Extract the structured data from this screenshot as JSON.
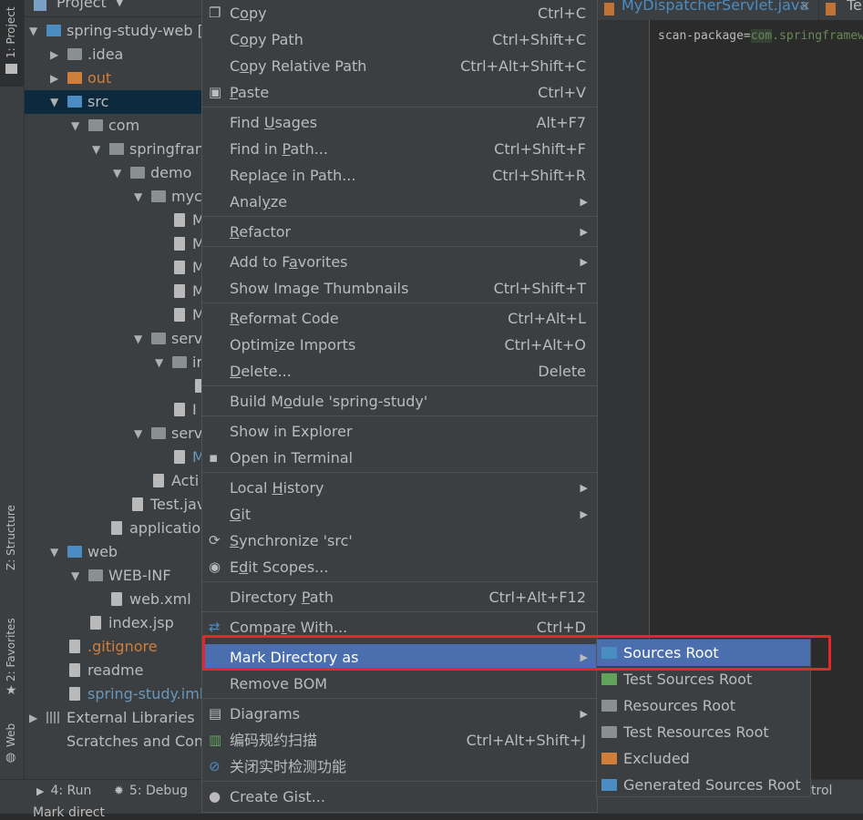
{
  "left_strip": {
    "project_tab": "1: Project",
    "structure_tab": "Z: Structure",
    "favorites_tab": "2: Favorites",
    "web_tab": "Web"
  },
  "project_panel": {
    "header": "Project",
    "tree": [
      {
        "label": "spring-study-web [",
        "kind": "folder-b",
        "expanded": true
      },
      {
        "label": ".idea",
        "kind": "folder",
        "expanded": false
      },
      {
        "label": "out",
        "kind": "folder-o",
        "expanded": false
      },
      {
        "label": "src",
        "kind": "folder-b",
        "expanded": true
      },
      {
        "label": "com",
        "kind": "folder",
        "expanded": true
      },
      {
        "label": "springfran",
        "kind": "folder",
        "expanded": true
      },
      {
        "label": "demo",
        "kind": "folder",
        "expanded": true
      },
      {
        "label": "myc",
        "kind": "folder",
        "expanded": true
      },
      {
        "label": "M",
        "kind": "file"
      },
      {
        "label": "M",
        "kind": "file"
      },
      {
        "label": "M",
        "kind": "file"
      },
      {
        "label": "M",
        "kind": "file"
      },
      {
        "label": "M",
        "kind": "file"
      },
      {
        "label": "serv",
        "kind": "folder",
        "expanded": true
      },
      {
        "label": "in",
        "kind": "folder",
        "expanded": true
      },
      {
        "label": "",
        "kind": "file"
      },
      {
        "label": "I",
        "kind": "file"
      },
      {
        "label": "serv",
        "kind": "folder",
        "expanded": true
      },
      {
        "label": "M",
        "kind": "file"
      },
      {
        "label": "Acti",
        "kind": "file"
      },
      {
        "label": "Test.java",
        "kind": "file"
      },
      {
        "label": "application.p",
        "kind": "file"
      },
      {
        "label": "web",
        "kind": "folder-b",
        "expanded": true
      },
      {
        "label": "WEB-INF",
        "kind": "folder",
        "expanded": true
      },
      {
        "label": "web.xml",
        "kind": "file"
      },
      {
        "label": "index.jsp",
        "kind": "file"
      },
      {
        "label": ".gitignore",
        "kind": "file"
      },
      {
        "label": "readme",
        "kind": "file"
      },
      {
        "label": "spring-study.iml",
        "kind": "file"
      },
      {
        "label": "External Libraries",
        "kind": "lib",
        "expanded": false
      },
      {
        "label": "Scratches and Cons",
        "kind": "scratch"
      }
    ]
  },
  "editor": {
    "tab_active": "MyDispatcherServlet.java",
    "tab_next": "Te",
    "code_attr": "scan-package",
    "code_eq": "=",
    "code_val_1": "com",
    "code_val_2": ".springframew"
  },
  "context_menu": {
    "items": [
      {
        "label": "Copy",
        "shortcut": "Ctrl+C",
        "icon": "copy-icon"
      },
      {
        "label": "Copy Path",
        "shortcut": "Ctrl+Shift+C"
      },
      {
        "label": "Copy Relative Path",
        "shortcut": "Ctrl+Alt+Shift+C"
      },
      {
        "label": "Paste",
        "shortcut": "Ctrl+V",
        "icon": "paste-icon"
      },
      {
        "label": "Find Usages",
        "shortcut": "Alt+F7"
      },
      {
        "label": "Find in Path...",
        "shortcut": "Ctrl+Shift+F"
      },
      {
        "label": "Replace in Path...",
        "shortcut": "Ctrl+Shift+R"
      },
      {
        "label": "Analyze",
        "shortcut": "",
        "submenu": true
      },
      {
        "label": "Refactor",
        "shortcut": "",
        "submenu": true
      },
      {
        "label": "Add to Favorites",
        "shortcut": "",
        "submenu": true
      },
      {
        "label": "Show Image Thumbnails",
        "shortcut": "Ctrl+Shift+T"
      },
      {
        "label": "Reformat Code",
        "shortcut": "Ctrl+Alt+L"
      },
      {
        "label": "Optimize Imports",
        "shortcut": "Ctrl+Alt+O"
      },
      {
        "label": "Delete...",
        "shortcut": "Delete"
      },
      {
        "label": "Build Module 'spring-study'",
        "shortcut": ""
      },
      {
        "label": "Show in Explorer",
        "shortcut": ""
      },
      {
        "label": "Open in Terminal",
        "shortcut": "",
        "icon": "terminal-icon"
      },
      {
        "label": "Local History",
        "shortcut": "",
        "submenu": true
      },
      {
        "label": "Git",
        "shortcut": "",
        "submenu": true
      },
      {
        "label": "Synchronize 'src'",
        "shortcut": "",
        "icon": "sync-icon"
      },
      {
        "label": "Edit Scopes...",
        "shortcut": "",
        "icon": "scope-icon"
      },
      {
        "label": "Directory Path",
        "shortcut": "Ctrl+Alt+F12"
      },
      {
        "label": "Compare With...",
        "shortcut": "Ctrl+D",
        "icon": "compare-icon"
      },
      {
        "label": "Mark Directory as",
        "shortcut": "",
        "submenu": true,
        "highlighted": true
      },
      {
        "label": "Remove BOM",
        "shortcut": ""
      },
      {
        "label": "Diagrams",
        "shortcut": "",
        "submenu": true,
        "icon": "diagram-icon"
      },
      {
        "label": "编码规约扫描",
        "shortcut": "Ctrl+Alt+Shift+J",
        "icon": "scan-icon"
      },
      {
        "label": "关闭实时检测功能",
        "shortcut": "",
        "icon": "stop-icon"
      },
      {
        "label": "Create Gist...",
        "shortcut": "",
        "icon": "github-icon"
      }
    ]
  },
  "submenu": {
    "items": [
      {
        "label": "Sources Root",
        "color": "#4b8cc2",
        "highlighted": true
      },
      {
        "label": "Test Sources Root",
        "color": "#62a35c"
      },
      {
        "label": "Resources Root",
        "color": "#8a8f92"
      },
      {
        "label": "Test Resources Root",
        "color": "#8a8f92"
      },
      {
        "label": "Excluded",
        "color": "#d07e3c"
      },
      {
        "label": "Generated Sources Root",
        "color": "#4b8cc2"
      }
    ]
  },
  "bottom_bar": {
    "run_tab": "4: Run",
    "debug_tab": "5: Debug",
    "right_fragment": "trol",
    "status_fragment": "Mark direct"
  },
  "colors": {
    "highlight": "#4b6eaf",
    "annotation": "#e8262a",
    "panel": "#3c3f41",
    "editor_bg": "#2b2b2b"
  }
}
